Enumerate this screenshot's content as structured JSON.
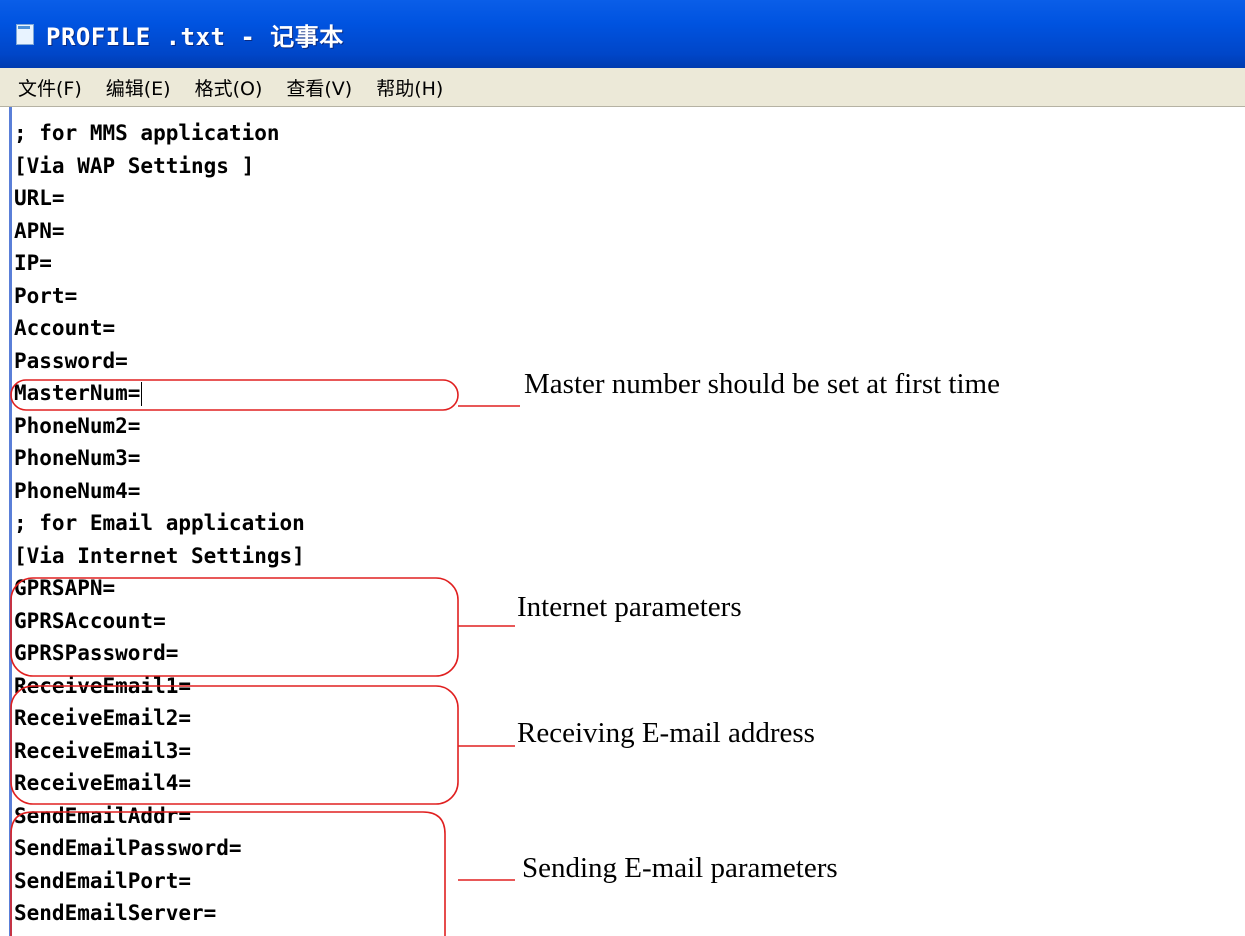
{
  "window": {
    "title": "PROFILE .txt - 记事本",
    "icon": "notepad-icon",
    "titlebar_color": "#0053e0"
  },
  "menu": [
    "文件(F)",
    "编辑(E)",
    "格式(O)",
    "查看(V)",
    "帮助(H)"
  ],
  "lines": [
    "; for MMS application",
    "[Via WAP Settings ]",
    "URL=",
    "APN=",
    "IP=",
    "Port=",
    "Account=",
    "Password=",
    "MasterNum=",
    "PhoneNum2=",
    "PhoneNum3=",
    "PhoneNum4=",
    "; for Email application",
    "[Via Internet Settings]",
    "GPRSAPN=",
    "GPRSAccount=",
    "GPRSPassword=",
    "ReceiveEmail1=",
    "ReceiveEmail2=",
    "ReceiveEmail3=",
    "ReceiveEmail4=",
    "SendEmailAddr=",
    "SendEmailPassword=",
    "SendEmailPort=",
    "SendEmailServer="
  ],
  "annotations": [
    {
      "text": "Master number should be set at first time"
    },
    {
      "text": "Internet parameters"
    },
    {
      "text": "Receiving E-mail address"
    },
    {
      "text": "Sending E-mail parameters"
    }
  ],
  "annotation_color": "#e02020"
}
